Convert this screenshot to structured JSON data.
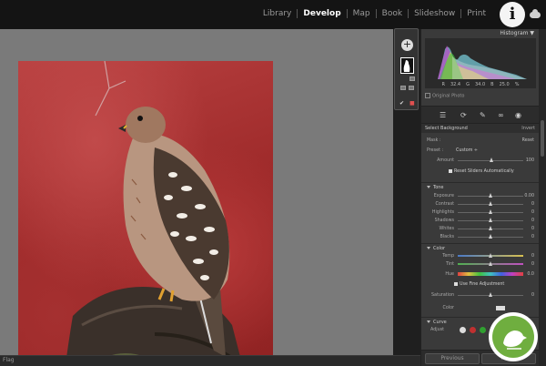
{
  "modules": [
    {
      "label": "Library",
      "active": false
    },
    {
      "label": "Develop",
      "active": true
    },
    {
      "label": "Map",
      "active": false
    },
    {
      "label": "Book",
      "active": false
    },
    {
      "label": "Slideshow",
      "active": false
    },
    {
      "label": "Print",
      "active": false
    }
  ],
  "info_icon": "i",
  "histogram": {
    "title": "Histogram ▼",
    "readouts": [
      "R",
      "32.4",
      "G",
      "34.0",
      "B",
      "25.0",
      "%"
    ],
    "original_photo": "Original Photo"
  },
  "mask": {
    "add_icon": "+",
    "select_label": "Select Background",
    "invert": "Invert",
    "mask_label": "Mask :",
    "reset": "Reset",
    "preset_label": "Preset :",
    "preset_value": "Custom ÷",
    "amount_label": "Amount",
    "amount_value": "100",
    "reset_sliders": "Reset Sliders Automatically"
  },
  "sections": {
    "tone": "Tone",
    "color": "Color",
    "curve": "Curve",
    "adjust": "Adjust"
  },
  "tone": [
    {
      "label": "Exposure",
      "value": "0.00",
      "pos": 0.5
    },
    {
      "label": "Contrast",
      "value": "0",
      "pos": 0.5
    },
    {
      "label": "Highlights",
      "value": "0",
      "pos": 0.5
    },
    {
      "label": "Shadows",
      "value": "0",
      "pos": 0.5
    },
    {
      "label": "Whites",
      "value": "0",
      "pos": 0.5
    },
    {
      "label": "Blacks",
      "value": "0",
      "pos": 0.5
    }
  ],
  "color": {
    "temp": {
      "label": "Temp",
      "value": "0",
      "pos": 0.5
    },
    "tint": {
      "label": "Tint",
      "value": "0",
      "pos": 0.5
    },
    "hue": {
      "label": "Hue",
      "value": "0.0",
      "pos": 0.5
    },
    "fine_adjust": "Use Fine Adjustment",
    "saturation": {
      "label": "Saturation",
      "value": "0",
      "pos": 0.5
    },
    "color_label": "Color"
  },
  "footer": {
    "previous": "Previous",
    "reset": "Reset"
  },
  "bottom_label": "Flag"
}
